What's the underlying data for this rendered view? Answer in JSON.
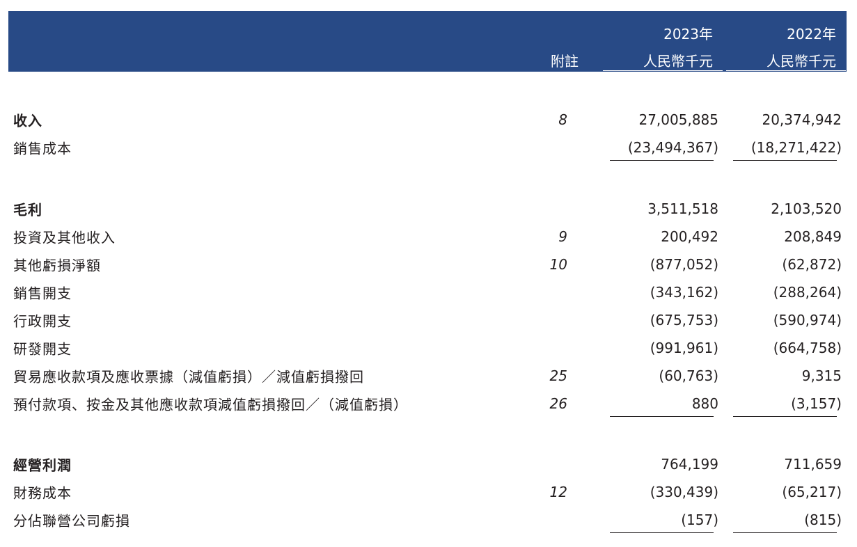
{
  "header": {
    "note_label": "附註",
    "year_2023": "2023年",
    "currency_2023": "人民幣千元",
    "year_2022": "2022年",
    "currency_2022": "人民幣千元",
    "band_color": "#284a86"
  },
  "rows": [
    {
      "label": "收入",
      "note": "8",
      "v2023": "27,005,885",
      "v2022": "20,374,942",
      "bold": true
    },
    {
      "label": "銷售成本",
      "note": "",
      "v2023": "(23,494,367)",
      "v2022": "(18,271,422)",
      "bold": false
    },
    {
      "label": "毛利",
      "note": "",
      "v2023": "3,511,518",
      "v2022": "2,103,520",
      "bold": true
    },
    {
      "label": "投資及其他收入",
      "note": "9",
      "v2023": "200,492",
      "v2022": "208,849",
      "bold": false
    },
    {
      "label": "其他虧損淨額",
      "note": "10",
      "v2023": "(877,052)",
      "v2022": "(62,872)",
      "bold": false
    },
    {
      "label": "銷售開支",
      "note": "",
      "v2023": "(343,162)",
      "v2022": "(288,264)",
      "bold": false
    },
    {
      "label": "行政開支",
      "note": "",
      "v2023": "(675,753)",
      "v2022": "(590,974)",
      "bold": false
    },
    {
      "label": "研發開支",
      "note": "",
      "v2023": "(991,961)",
      "v2022": "(664,758)",
      "bold": false
    },
    {
      "label": "貿易應收款項及應收票據（減值虧損）／減值虧損撥回",
      "note": "25",
      "v2023": "(60,763)",
      "v2022": "9,315",
      "bold": false
    },
    {
      "label": "預付款項、按金及其他應收款項減值虧損撥回／（減值虧損）",
      "note": "26",
      "v2023": "880",
      "v2022": "(3,157)",
      "bold": false
    },
    {
      "label": "經營利潤",
      "note": "",
      "v2023": "764,199",
      "v2022": "711,659",
      "bold": true
    },
    {
      "label": "財務成本",
      "note": "12",
      "v2023": "(330,439)",
      "v2022": "(65,217)",
      "bold": false
    },
    {
      "label": "分佔聯營公司虧損",
      "note": "",
      "v2023": "(157)",
      "v2022": "(815)",
      "bold": false
    }
  ]
}
